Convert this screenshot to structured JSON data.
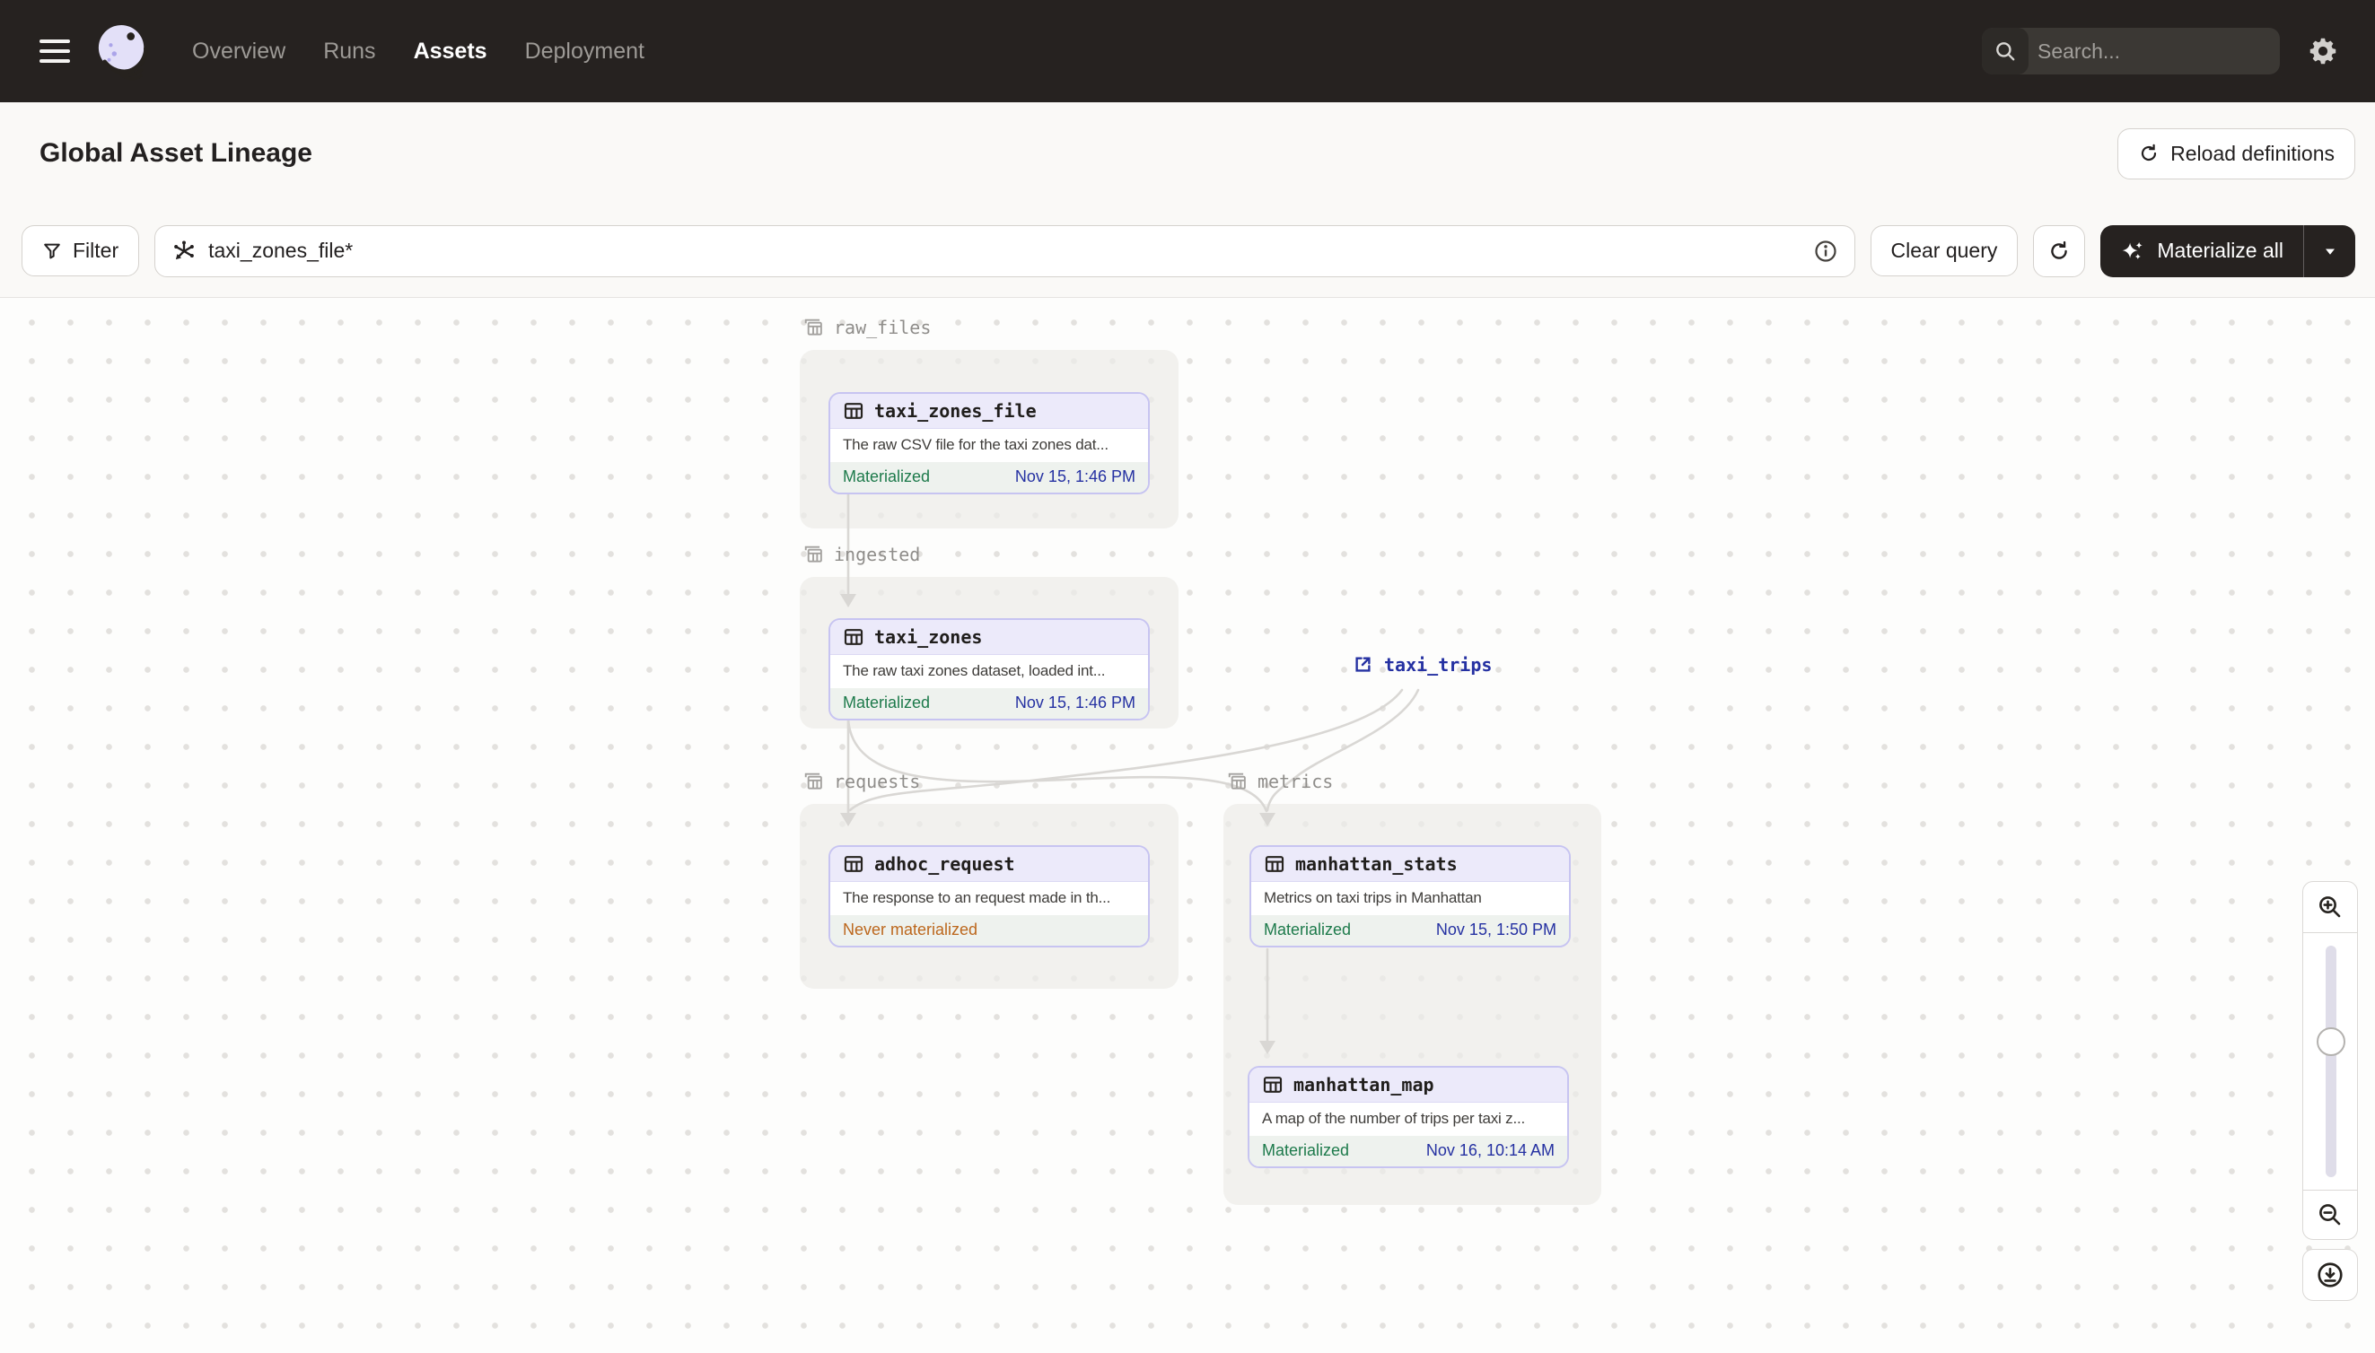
{
  "nav": {
    "items": [
      {
        "label": "Overview"
      },
      {
        "label": "Runs"
      },
      {
        "label": "Assets"
      },
      {
        "label": "Deployment"
      }
    ],
    "search": {
      "placeholder": "Search...",
      "shortcut": "/"
    }
  },
  "header": {
    "title": "Global Asset Lineage",
    "reload_button": "Reload definitions"
  },
  "toolbar": {
    "filter_button": "Filter",
    "query_value": "taxi_zones_file*",
    "clear_button": "Clear query",
    "materialize_button": "Materialize all"
  },
  "graph": {
    "groups": [
      {
        "name": "raw_files"
      },
      {
        "name": "ingested"
      },
      {
        "name": "requests"
      },
      {
        "name": "metrics"
      }
    ],
    "nodes": [
      {
        "name": "taxi_zones_file",
        "group": "raw_files",
        "description": "The raw CSV file for the taxi zones dat...",
        "status": "Materialized",
        "timestamp": "Nov 15, 1:46 PM"
      },
      {
        "name": "taxi_zones",
        "group": "ingested",
        "description": "The raw taxi zones dataset, loaded int...",
        "status": "Materialized",
        "timestamp": "Nov 15, 1:46 PM"
      },
      {
        "name": "adhoc_request",
        "group": "requests",
        "description": "The response to an request made in th...",
        "status": "Never materialized",
        "timestamp": ""
      },
      {
        "name": "manhattan_stats",
        "group": "metrics",
        "description": "Metrics on taxi trips in Manhattan",
        "status": "Materialized",
        "timestamp": "Nov 15, 1:50 PM"
      },
      {
        "name": "manhattan_map",
        "group": "metrics",
        "description": "A map of the number of trips per taxi z...",
        "status": "Materialized",
        "timestamp": "Nov 16, 10:14 AM"
      }
    ],
    "external_asset": {
      "name": "taxi_trips"
    }
  },
  "icons": {
    "menu": "hamburger-icon",
    "logo": "dagster-logo",
    "search": "search-icon",
    "settings": "gear-icon",
    "reload": "refresh-icon",
    "filter": "funnel-icon",
    "query": "asset-selector-icon",
    "info": "info-icon",
    "materialize": "sparkle-icon",
    "caret": "chevron-down-icon",
    "asset": "table-icon",
    "group": "stacked-table-icon",
    "external": "external-link-icon",
    "zoom_in": "zoom-in-icon",
    "zoom_out": "zoom-out-icon",
    "recenter": "recenter-icon"
  },
  "colors": {
    "nav_bg": "#262220",
    "accent_lavender": "#C7C4F1",
    "node_header": "#ECEAFA",
    "materialized_green": "#1D7A4B",
    "never_materialized_orange": "#BC671D",
    "timestamp_navy": "#2531A2",
    "edge_gray": "#D9D7D4"
  }
}
